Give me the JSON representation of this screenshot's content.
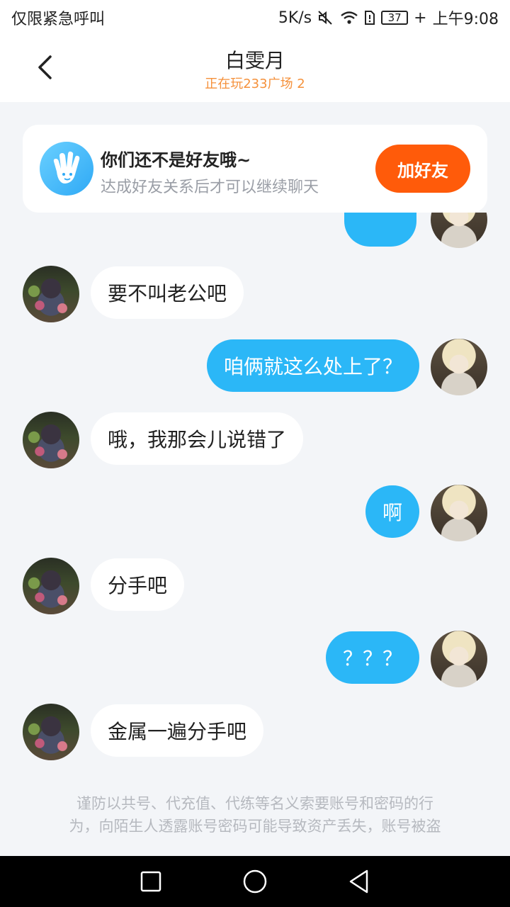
{
  "status_bar": {
    "carrier_text": "仅限紧急呼叫",
    "network_speed": "5K/s",
    "battery": "37",
    "time": "上午9:08"
  },
  "header": {
    "title": "白雯月",
    "subtitle": "正在玩233广场 2"
  },
  "friend_banner": {
    "title": "你们还不是好友哦~",
    "subtitle": "达成好友关系后才可以继续聊天",
    "button_label": "加好友"
  },
  "messages": [
    {
      "sender": "other",
      "text": "要不叫老公吧"
    },
    {
      "sender": "me",
      "text": "咱俩就这么处上了？"
    },
    {
      "sender": "other",
      "text": "哦，我那会儿说错了"
    },
    {
      "sender": "me",
      "text": "啊"
    },
    {
      "sender": "other",
      "text": "分手吧"
    },
    {
      "sender": "me",
      "text": "？？？"
    },
    {
      "sender": "other",
      "text": "金属一遍分手吧"
    }
  ],
  "notice": {
    "line1": "谨防以共号、代充值、代练等名义索要账号和密码的行",
    "line2": "为，向陌生人透露账号密码可能导致资产丢失，账号被盗"
  },
  "colors": {
    "accent_blue": "#2bb7f7",
    "add_friend_orange": "#ff5b0a",
    "subtitle_orange": "#f5913b"
  },
  "icons": [
    "mute-icon",
    "wifi-icon",
    "sim-icon",
    "battery-icon",
    "back-icon",
    "hand-wave-icon",
    "recents-icon",
    "home-icon",
    "back-nav-icon"
  ]
}
